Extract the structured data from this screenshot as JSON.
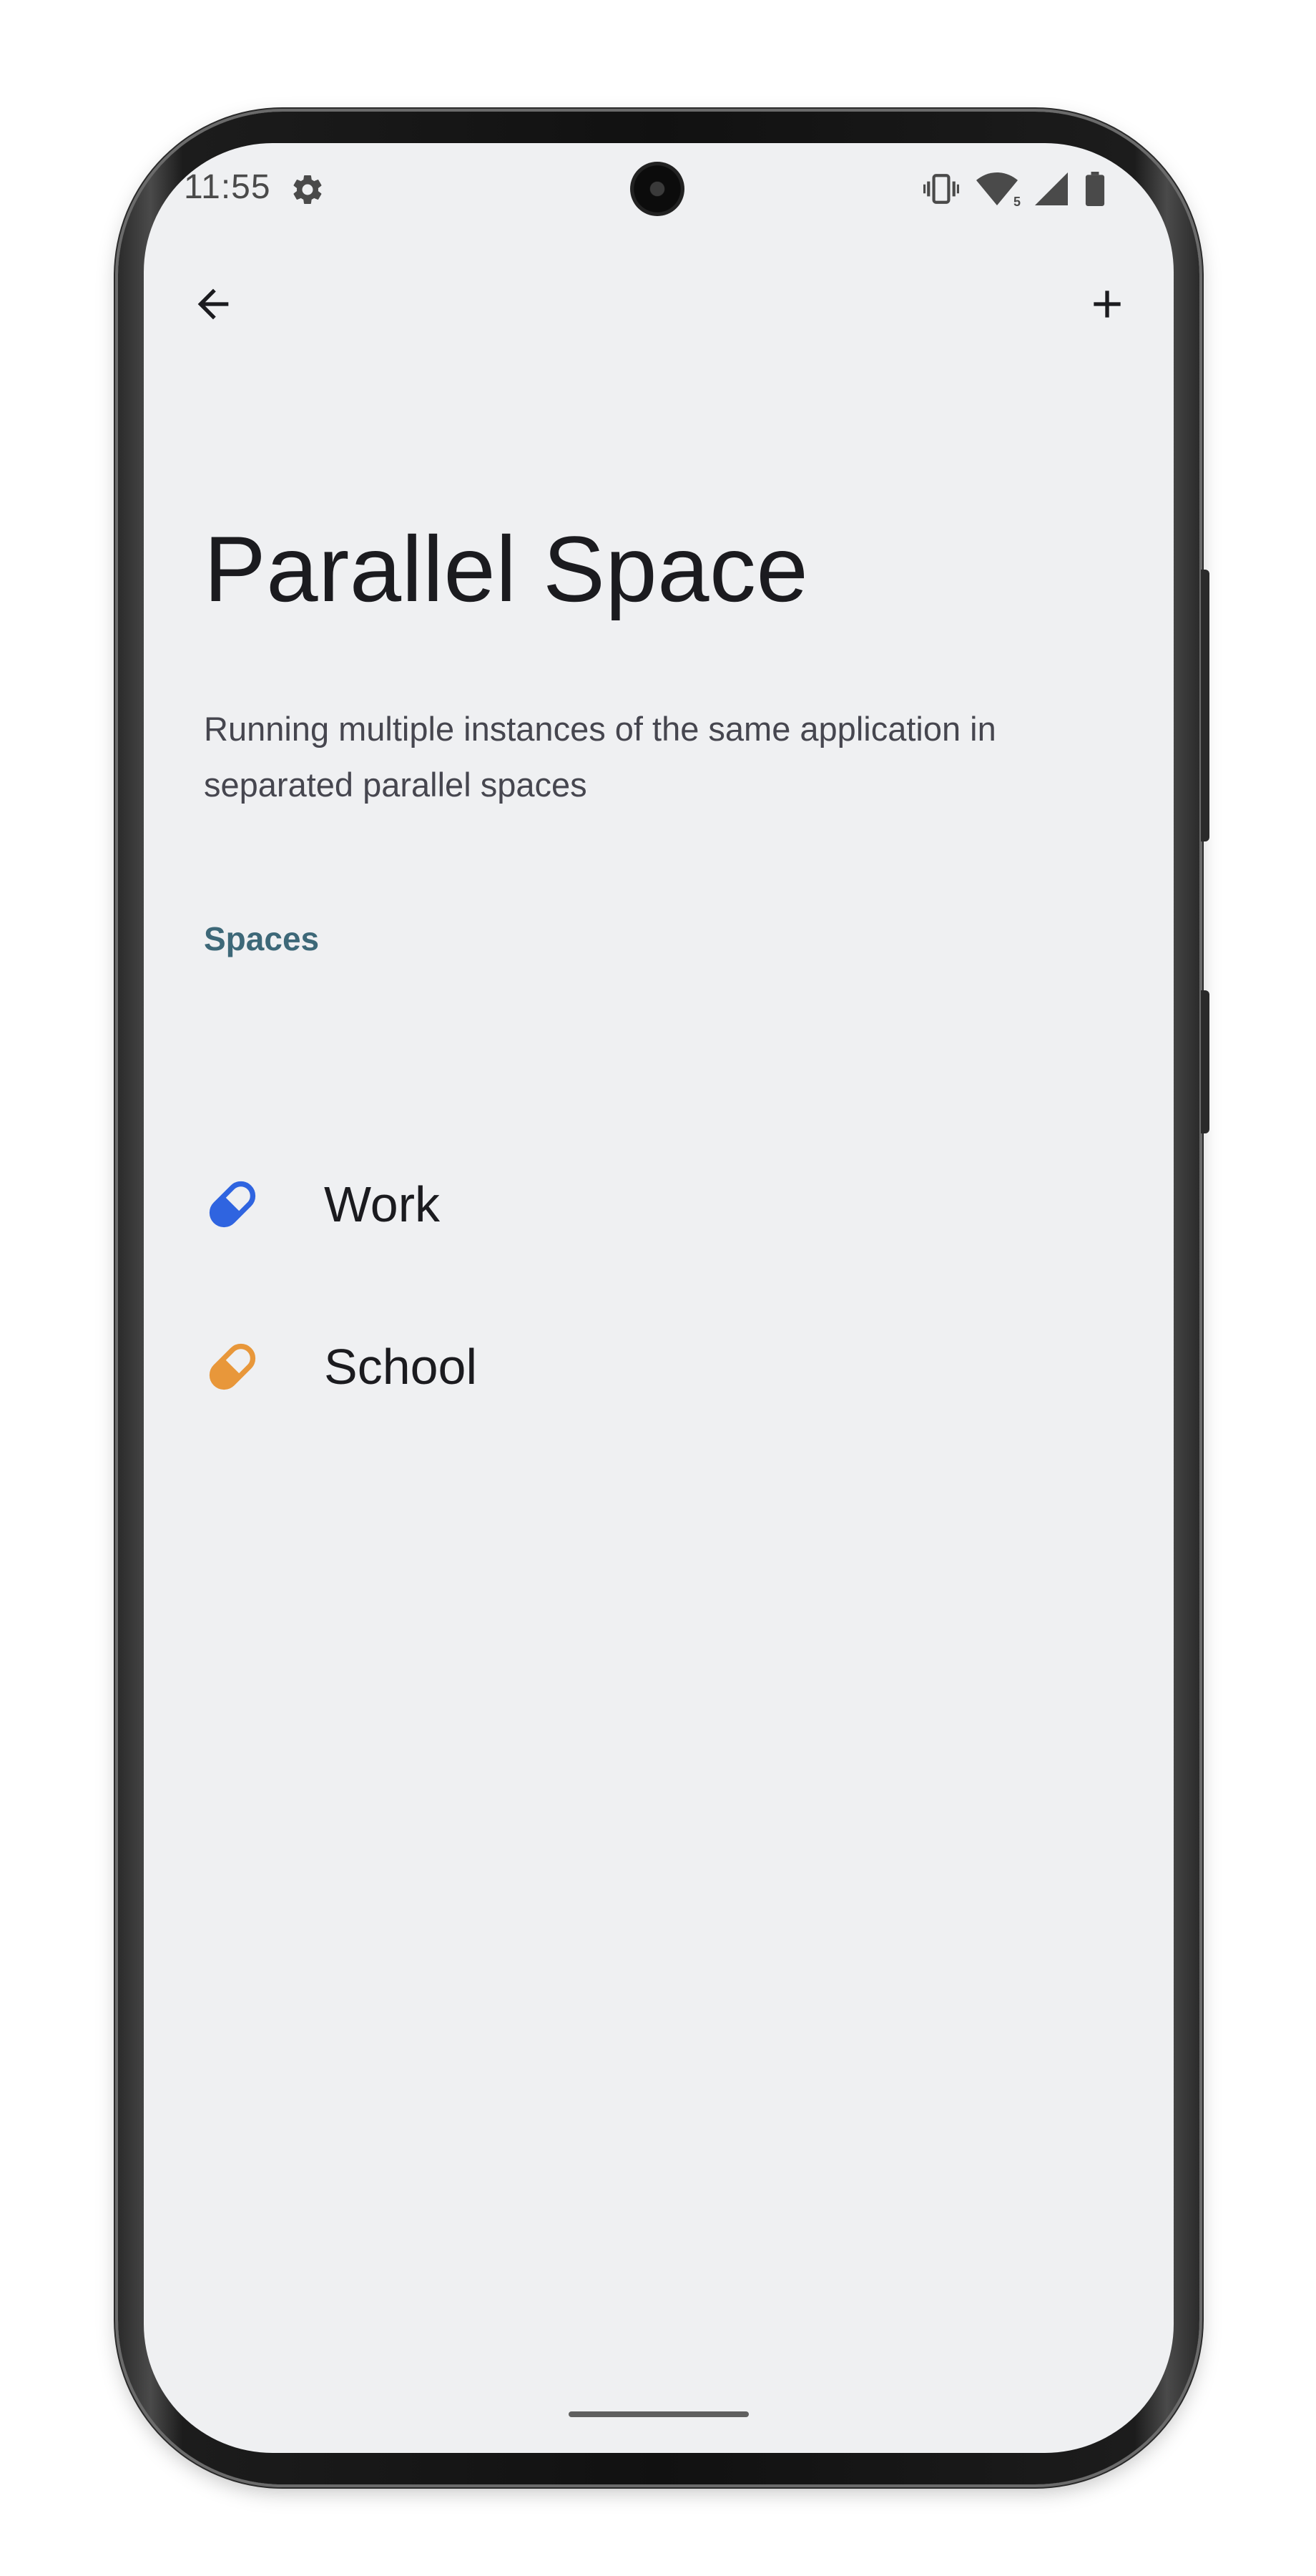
{
  "status_bar": {
    "time": "11:55",
    "icons": [
      "settings-icon",
      "vibrate-icon",
      "wifi-icon",
      "cell-signal-icon",
      "battery-icon"
    ],
    "wifi_badge": "5"
  },
  "app_bar": {
    "back_icon": "arrow-back-icon",
    "add_icon": "plus-icon"
  },
  "page": {
    "title": "Parallel Space",
    "description": "Running multiple instances of the same application in separated parallel spaces"
  },
  "spaces": {
    "header": "Spaces",
    "items": [
      {
        "label": "Work",
        "icon": "pill-icon",
        "color": "#2f64e0"
      },
      {
        "label": "School",
        "icon": "pill-icon",
        "color": "#e8973a"
      }
    ]
  },
  "colors": {
    "background": "#eff0f2",
    "section_header": "#3d6878"
  }
}
